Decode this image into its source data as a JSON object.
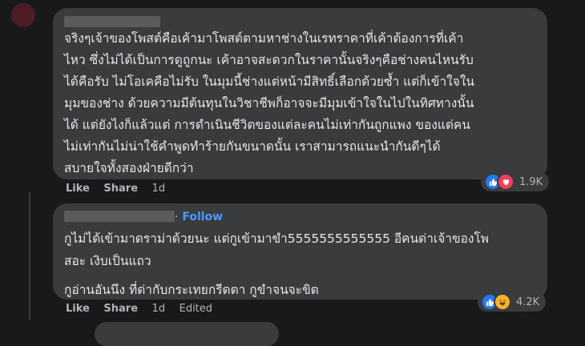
{
  "comment1": {
    "author": "",
    "lines": [
      "จริงๆเจ้าของโพสต์คือเค้ามาโพสต์ตามหาช่างในเรทราคาที่เค้าต้องการที่เค้า",
      "ไหว ซึ่งไม่ได้เป็นการดูถูกนะ เค้าอาจสะดวกในราคานั้นจริงๆคือช่างคนไหนรับ",
      "ได้คือรับ ไม่โอเคคือไม่รับ ในมุมนี้ช่างแต่หน้ามีสิทธิ์เลือกด้วยซ้ำ แต่ก็เข้าใจใน",
      "มุมของช่าง ด้วยความมีต้นทุนในวิชาชีพก็อาจจะมีมุมเข้าใจในไปในทิศทางนั้น",
      "ได้ แต่ยังไงก็แล้วแต่ การดำเนินชีวิตของแต่ละคนไม่เท่ากันถูกแพง ของแต่คน",
      "ไม่เท่ากันไม่น่าใช้คำพูดทำร้ายกันขนาดนั้น เราสามารถแนะนำกันดีๆได้",
      "สบายใจทั้งสองฝ่ายดีกว่า"
    ],
    "actions": {
      "like": "Like",
      "share": "Share",
      "time": "1d"
    },
    "reaction_count": "1.9K",
    "reaction_icons": [
      "like-icon",
      "love-icon"
    ]
  },
  "comment2": {
    "author": "",
    "follow_label": "Follow",
    "paragraph1": [
      "กูไม่ได้เข้ามาดราม่าด้วยนะ แต่กูเข้ามาขำ5555555555555 อีคนด่าเจ้าของโพ",
      "สอะ เงิบเป็นแถว"
    ],
    "paragraph2": "กูอ่านอันนึง ที่ด่ากับกระเทยกรีดตา กูขำจนจะขิต",
    "actions": {
      "like": "Like",
      "share": "Share",
      "time": "1d",
      "edited": "Edited"
    },
    "reaction_count": "4.2K",
    "reaction_icons": [
      "like-icon",
      "haha-icon"
    ]
  },
  "colors": {
    "background": "#18191a",
    "bubble": "#3a3b3c",
    "text": "#e4e6eb",
    "muted": "#b0b3b8",
    "link": "#4599ff"
  }
}
